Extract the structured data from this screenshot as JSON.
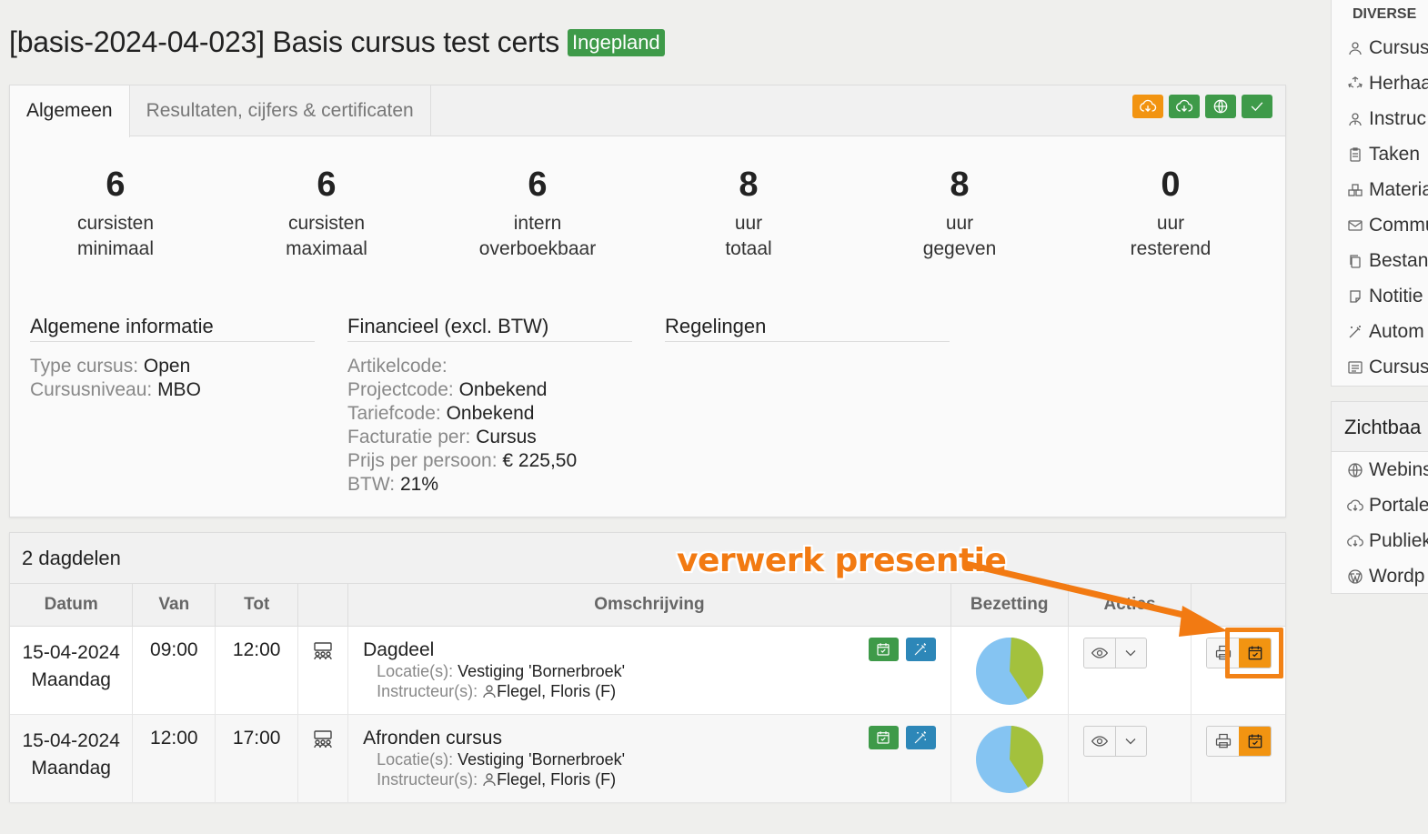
{
  "header": {
    "title": "[basis-2024-04-023] Basis cursus test certs",
    "status": "Ingepland"
  },
  "tabs": [
    {
      "label": "Algemeen",
      "active": true
    },
    {
      "label": "Resultaten, cijfers & certificaten",
      "active": false
    }
  ],
  "tab_actions": [
    {
      "icon": "cloud-download-icon",
      "color": "#f29411"
    },
    {
      "icon": "cloud-download-icon",
      "color": "#3e9a49"
    },
    {
      "icon": "globe-icon",
      "color": "#3e9a49"
    },
    {
      "icon": "check-icon",
      "color": "#3e9a49"
    }
  ],
  "stats": [
    {
      "value": "6",
      "line1": "cursisten",
      "line2": "minimaal"
    },
    {
      "value": "6",
      "line1": "cursisten",
      "line2": "maximaal"
    },
    {
      "value": "6",
      "line1": "intern",
      "line2": "overboekbaar"
    },
    {
      "value": "8",
      "line1": "uur",
      "line2": "totaal"
    },
    {
      "value": "8",
      "line1": "uur",
      "line2": "gegeven"
    },
    {
      "value": "0",
      "line1": "uur",
      "line2": "resterend"
    }
  ],
  "info": {
    "algemeen": {
      "title": "Algemene informatie",
      "rows": [
        {
          "key": "Type cursus:",
          "value": " Open"
        },
        {
          "key": "Cursusniveau:",
          "value": " MBO"
        }
      ]
    },
    "financieel": {
      "title": "Financieel (excl. BTW)",
      "rows": [
        {
          "key": "Artikelcode:",
          "value": ""
        },
        {
          "key": "Projectcode:",
          "value": " Onbekend"
        },
        {
          "key": "Tariefcode:",
          "value": " Onbekend"
        },
        {
          "key": "Facturatie per:",
          "value": " Cursus"
        },
        {
          "key": "Prijs per persoon:",
          "value": " € 225,50"
        },
        {
          "key": "BTW:",
          "value": " 21%"
        }
      ]
    },
    "regelingen": {
      "title": "Regelingen"
    }
  },
  "dagdelen": {
    "title": "2 dagdelen",
    "columns": [
      "Datum",
      "Van",
      "Tot",
      "",
      "Omschrijving",
      "Bezetting",
      "Acties",
      ""
    ],
    "rows": [
      {
        "date": "15-04-2024",
        "day": "Maandag",
        "from": "09:00",
        "to": "12:00",
        "title": "Dagdeel",
        "loc_key": "Locatie(s):",
        "loc_value": " Vestiging 'Bornerbroek'",
        "instr_key": "Instructeur(s):",
        "instr_value": "Flegel, Floris (F)",
        "occupancy_fraction": 0.4
      },
      {
        "date": "15-04-2024",
        "day": "Maandag",
        "from": "12:00",
        "to": "17:00",
        "title": "Afronden cursus",
        "loc_key": "Locatie(s):",
        "loc_value": " Vestiging 'Bornerbroek'",
        "instr_key": "Instructeur(s):",
        "instr_value": "Flegel, Floris (F)",
        "occupancy_fraction": 0.4
      }
    ],
    "pie_colors": {
      "filled": "#a3c13d",
      "empty": "#85c4f2"
    }
  },
  "annotation": {
    "text": "verwerk presentie",
    "color": "#f27a12"
  },
  "sidebar": {
    "diverse": {
      "title": "DIVERSE",
      "items": [
        "Cursus",
        "Herhaa",
        "Instruc",
        "Taken",
        "Materia",
        "Commu",
        "Bestan",
        "Notitie",
        "Autom",
        "Cursus"
      ]
    },
    "zichtbaar": {
      "title": "Zichtbaa",
      "items": [
        "Webins",
        "Portale",
        "Publiek",
        "Wordp"
      ]
    }
  }
}
